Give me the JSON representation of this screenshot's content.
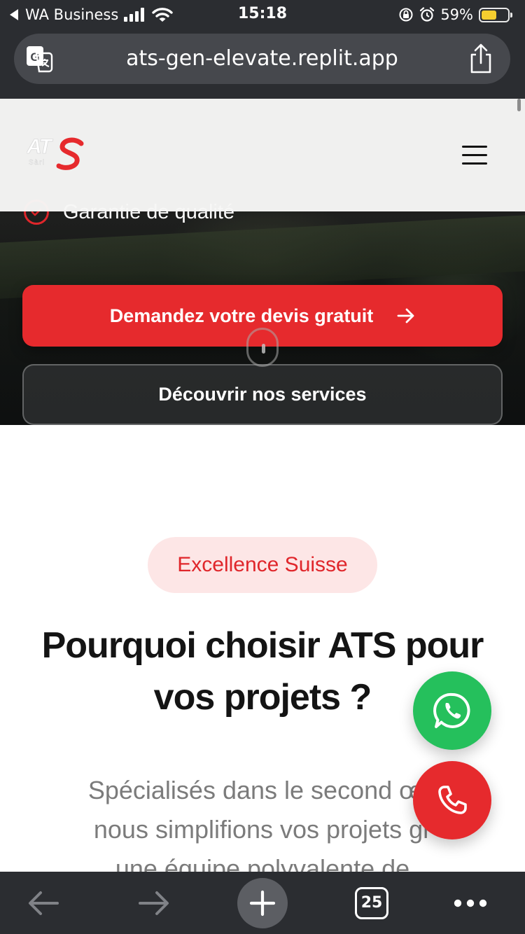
{
  "status_bar": {
    "back_app": "WA Business",
    "time": "15:18",
    "battery_percent": "59%",
    "battery_level": 0.59
  },
  "browser": {
    "url": "ats-gen-elevate.replit.app",
    "open_tabs": "25"
  },
  "site": {
    "logo_text": "ATS",
    "logo_sub": "Sàrl"
  },
  "hero": {
    "check_item": "Garantie de qualité",
    "primary_cta": "Demandez votre devis gratuit",
    "secondary_cta": "Découvrir nos services"
  },
  "why": {
    "badge": "Excellence Suisse",
    "title_line1": "Pourquoi choisir ATS pour",
    "title_line2": "vos projets ?",
    "desc_line1": "Spécialisés dans le second œu",
    "desc_line2": "nous simplifions vos projets gr",
    "desc_line3": "une équipe polyvalente de"
  },
  "colors": {
    "brand_red": "#e62a2d",
    "whatsapp_green": "#25c05c",
    "badge_bg": "#fde6e6",
    "browser_chrome": "#2b2d31"
  },
  "icons": {
    "translate": "translate-icon",
    "share": "share-icon",
    "menu": "hamburger-menu-icon",
    "whatsapp": "whatsapp-icon",
    "phone": "phone-icon",
    "check": "check-circle-icon",
    "arrow": "arrow-right-icon"
  }
}
